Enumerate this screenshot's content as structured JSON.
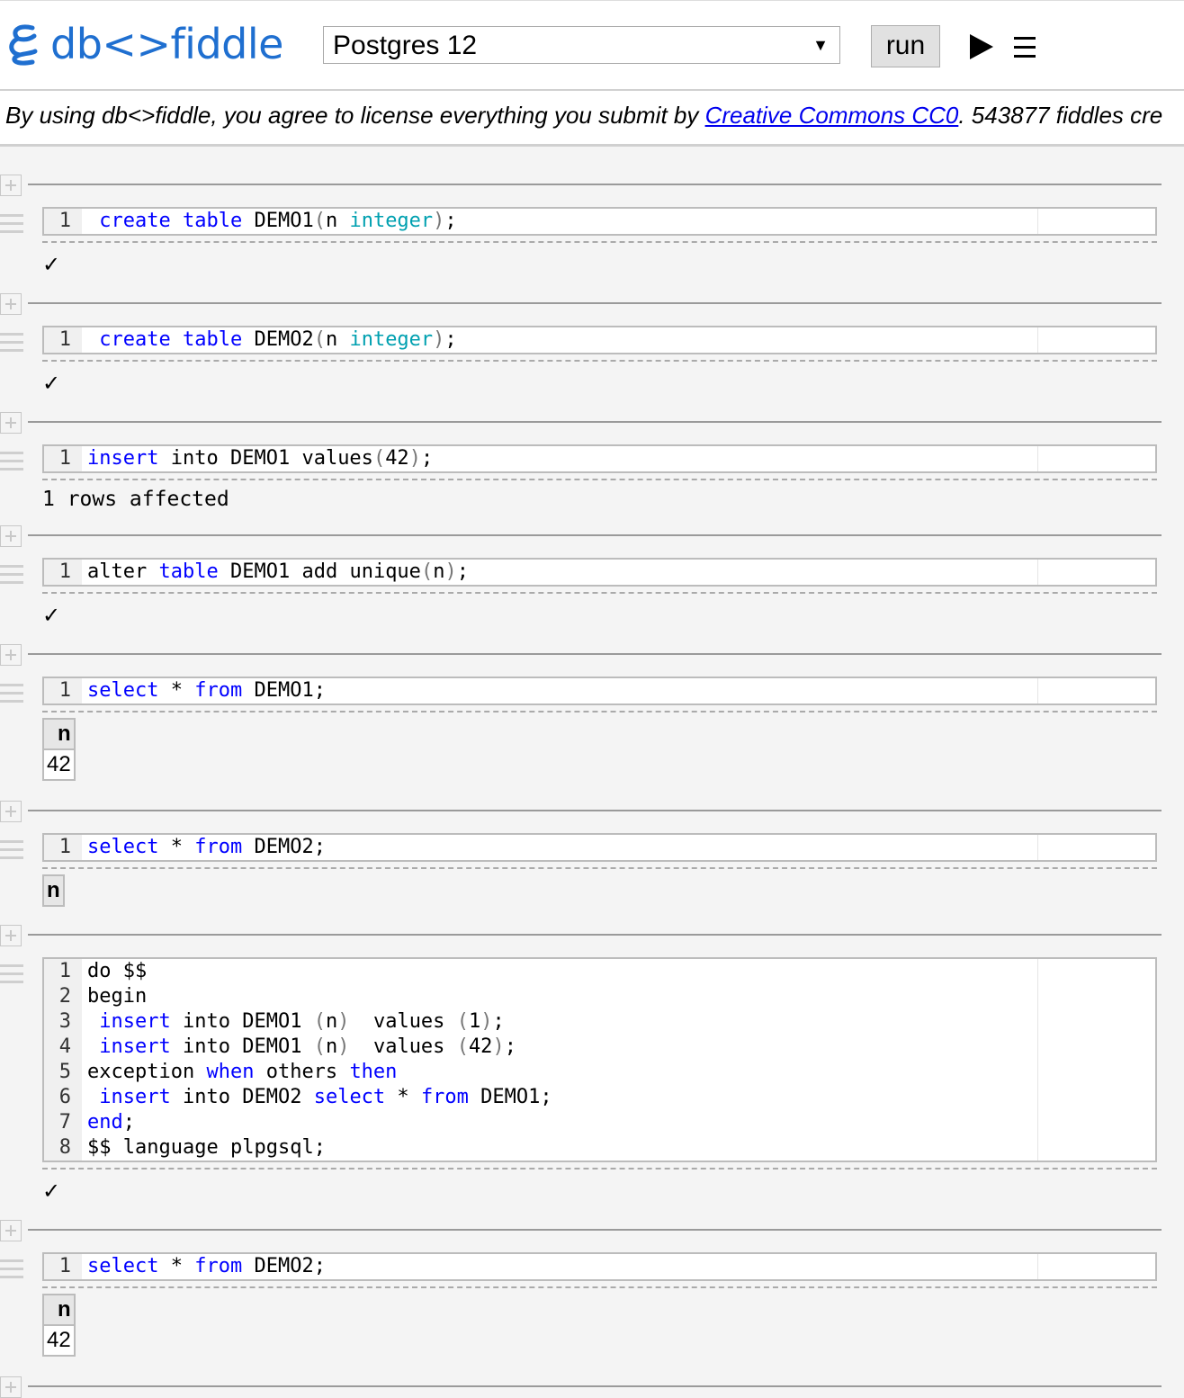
{
  "header": {
    "logo_text": "db<>fiddle",
    "db_select_value": "Postgres 12",
    "run_label": "run"
  },
  "notice": {
    "prefix": "By using db<>fiddle, you agree to license everything you submit by ",
    "link": "Creative Commons CC0",
    "suffix": ". 543877 fiddles cre"
  },
  "blocks": [
    {
      "lines": [
        {
          "n": "1",
          "code": " create table DEMO1(n integer);"
        }
      ],
      "result": {
        "type": "check",
        "text": "✓"
      }
    },
    {
      "lines": [
        {
          "n": "1",
          "code": " create table DEMO2(n integer);"
        }
      ],
      "result": {
        "type": "check",
        "text": "✓"
      }
    },
    {
      "lines": [
        {
          "n": "1",
          "code": "insert into DEMO1 values(42);"
        }
      ],
      "result": {
        "type": "text",
        "text": "1 rows affected"
      }
    },
    {
      "lines": [
        {
          "n": "1",
          "code": "alter table DEMO1 add unique(n);"
        }
      ],
      "result": {
        "type": "check",
        "text": "✓"
      }
    },
    {
      "lines": [
        {
          "n": "1",
          "code": "select * from DEMO1;"
        }
      ],
      "result": {
        "type": "table",
        "header": "n",
        "rows": [
          "42"
        ]
      }
    },
    {
      "lines": [
        {
          "n": "1",
          "code": "select * from DEMO2;"
        }
      ],
      "result": {
        "type": "table",
        "header": "n",
        "rows": []
      }
    },
    {
      "lines": [
        {
          "n": "1",
          "code": "do $$"
        },
        {
          "n": "2",
          "code": "begin"
        },
        {
          "n": "3",
          "code": " insert into DEMO1 (n)  values (1);"
        },
        {
          "n": "4",
          "code": " insert into DEMO1 (n)  values (42);"
        },
        {
          "n": "5",
          "code": "exception when others then"
        },
        {
          "n": "6",
          "code": " insert into DEMO2 select * from DEMO1;"
        },
        {
          "n": "7",
          "code": "end;"
        },
        {
          "n": "8",
          "code": "$$ language plpgsql;"
        }
      ],
      "result": {
        "type": "check",
        "text": "✓"
      }
    },
    {
      "lines": [
        {
          "n": "1",
          "code": "select * from DEMO2;"
        }
      ],
      "result": {
        "type": "table",
        "header": "n",
        "rows": [
          "42"
        ]
      }
    }
  ],
  "syntax": {
    "keywords": [
      "create",
      "table",
      "insert",
      "select",
      "from",
      "when",
      "then",
      "end"
    ],
    "types": [
      "integer"
    ]
  },
  "colors": {
    "logo": "#1f6fd0",
    "keyword": "#0000ff",
    "type": "#00a0b0",
    "link": "#0000ee"
  }
}
